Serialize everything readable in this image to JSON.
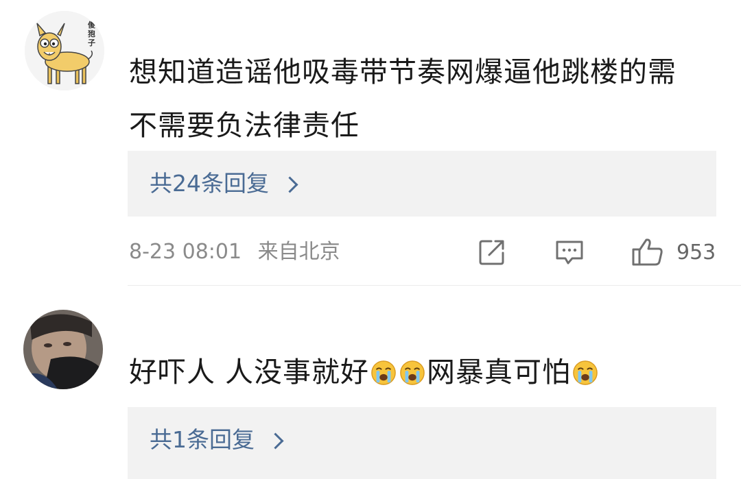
{
  "comments": [
    {
      "avatar_caption": "傻狍子",
      "text": "想知道造谣他吸毒带节奏网爆逼他跳楼的需不需要负法律责任",
      "reply_link": "共24条回复",
      "date": "8-23 08:01",
      "location": "来自北京",
      "like_count": "953"
    },
    {
      "text_part1": "好吓人 人没事就好",
      "text_part2": "网暴真可怕",
      "reply_link": "共1条回复"
    }
  ],
  "icons": {
    "share": "share-icon",
    "comment": "comment-icon",
    "like": "thumbs-up-icon",
    "emoji": "crying-face-icon"
  },
  "colors": {
    "link": "#4a6b94",
    "meta": "#8a8a8a",
    "reply_bg": "#f2f2f2"
  }
}
